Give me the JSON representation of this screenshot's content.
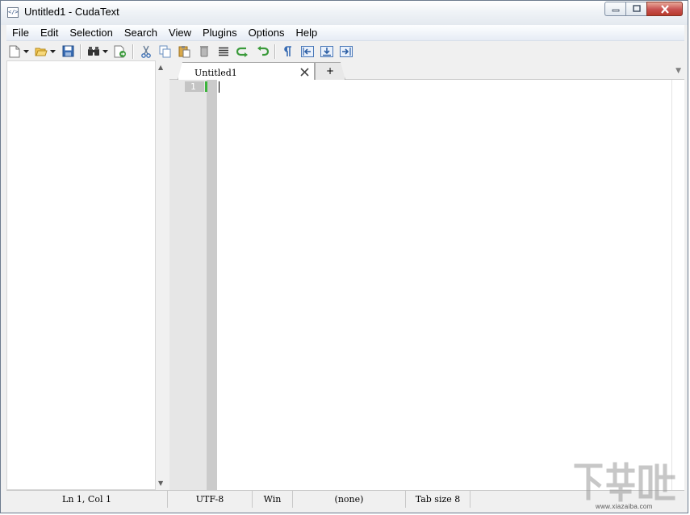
{
  "window": {
    "title": "Untitled1 - CudaText",
    "app_icon_text": "</>"
  },
  "menu": [
    "File",
    "Edit",
    "Selection",
    "Search",
    "View",
    "Plugins",
    "Options",
    "Help"
  ],
  "toolbar": {
    "icons": [
      "new-file",
      "open-file",
      "save",
      "find",
      "go-to",
      "cut",
      "copy",
      "paste",
      "delete",
      "select-all",
      "undo",
      "redo",
      "show-unprinted",
      "indent-left",
      "comment",
      "indent-right"
    ]
  },
  "tabs": {
    "active_label": "Untitled1",
    "add_label": "+"
  },
  "editor": {
    "line_numbers": [
      "1"
    ],
    "content": ""
  },
  "statusbar": {
    "position": "Ln 1, Col 1",
    "encoding": "UTF-8",
    "line_ending": "Win",
    "lexer": "(none)",
    "tab_size": "Tab size 8"
  },
  "watermark": {
    "url": "www.xiazaiba.com"
  },
  "colors": {
    "modified_marker": "#3cb43c",
    "close_button": "#c75050"
  }
}
